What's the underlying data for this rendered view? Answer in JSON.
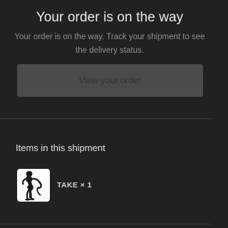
{
  "header": {
    "title": "Your order is on the way",
    "subtitle": "Your order is on the way. Track your shipment to see the delivery status."
  },
  "actions": {
    "view_order_label": "View your order"
  },
  "shipment": {
    "heading": "Items in this shipment",
    "items": [
      {
        "name": "TAKE",
        "quantity_text": "× 1",
        "label": "TAKE × 1",
        "image_icon": "product-figure-icon"
      }
    ]
  },
  "colors": {
    "background": "#202123",
    "button": "#4a4b4d",
    "divider": "#3a3b3d",
    "muted_text": "#8d8e90"
  }
}
